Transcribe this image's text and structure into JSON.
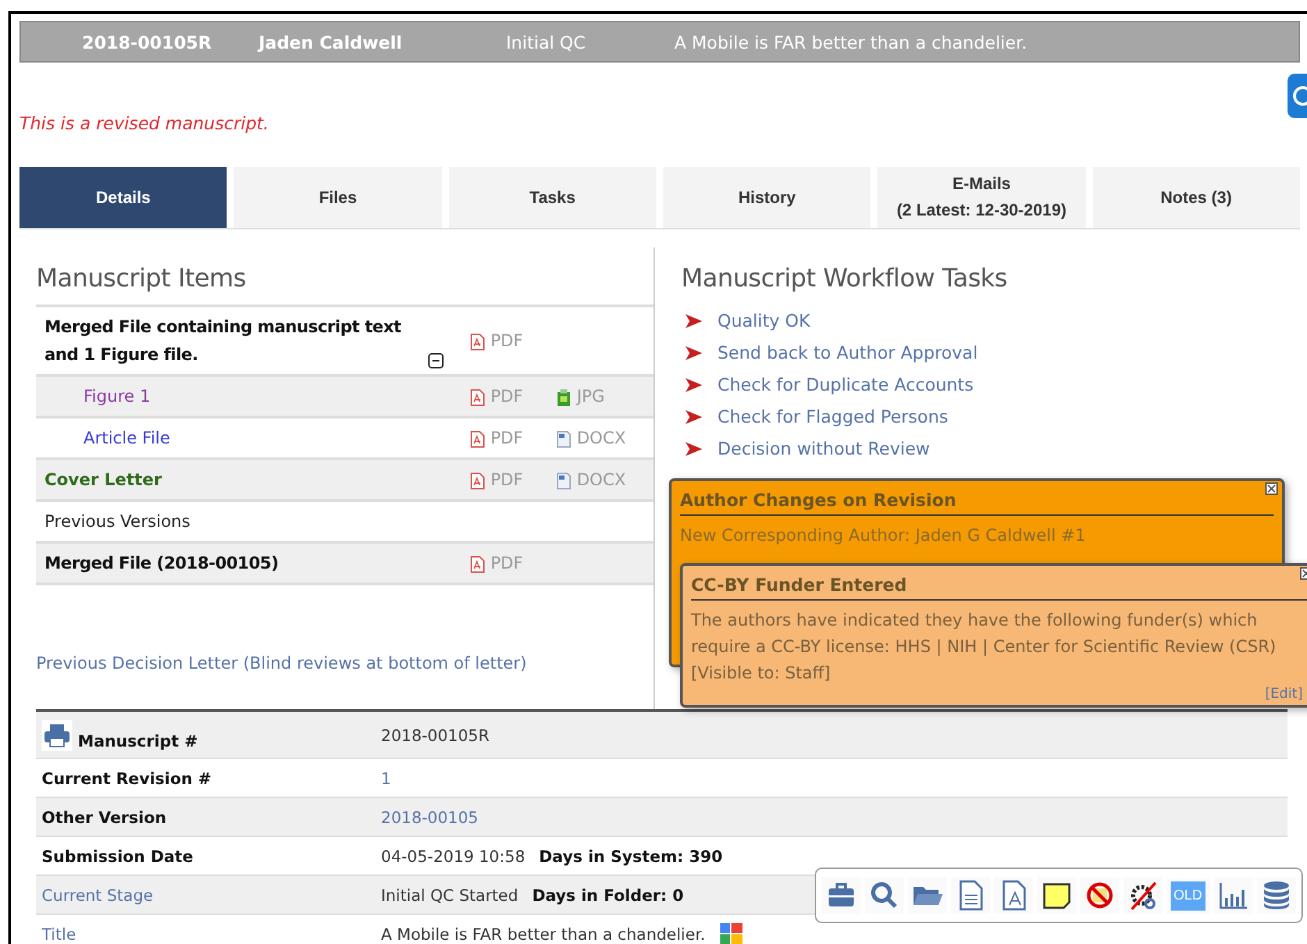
{
  "header": {
    "manuscript_id": "2018-00105R",
    "author": "Jaden Caldwell",
    "stage": "Initial QC",
    "title": "A Mobile is FAR better than a chandelier."
  },
  "revised_notice": "This is a revised manuscript.",
  "tabs": [
    {
      "label": "Details",
      "selected": true
    },
    {
      "label": "Files",
      "selected": false
    },
    {
      "label": "Tasks",
      "selected": false
    },
    {
      "label": "History",
      "selected": false
    },
    {
      "label": "E-Mails",
      "sublabel": "(2 Latest: 12-30-2019)",
      "selected": false
    },
    {
      "label": "Notes (3)",
      "selected": false
    }
  ],
  "manuscript_items": {
    "title": "Manuscript Items",
    "items": [
      {
        "label": "Merged File containing manuscript text and 1 Figure file.",
        "kind": "bold",
        "expanded": true,
        "files": [
          {
            "kind": "pdf",
            "label": "PDF"
          }
        ],
        "children": [
          {
            "label": "Figure 1",
            "kind": "visited-link",
            "files": [
              {
                "kind": "pdf",
                "label": "PDF"
              },
              {
                "kind": "image",
                "label": "JPG"
              }
            ]
          },
          {
            "label": "Article File",
            "kind": "link",
            "files": [
              {
                "kind": "pdf",
                "label": "PDF"
              },
              {
                "kind": "doc",
                "label": "DOCX"
              }
            ]
          }
        ]
      },
      {
        "label": "Cover Letter",
        "kind": "cover",
        "files": [
          {
            "kind": "pdf",
            "label": "PDF"
          },
          {
            "kind": "doc",
            "label": "DOCX"
          }
        ]
      },
      {
        "label": "Previous Versions",
        "kind": "plain"
      },
      {
        "label": "Merged File (2018-00105)",
        "kind": "bold",
        "files": [
          {
            "kind": "pdf",
            "label": "PDF"
          }
        ]
      }
    ],
    "decision_letter_link": "Previous Decision Letter (Blind reviews at bottom of letter)"
  },
  "workflow": {
    "title": "Manuscript Workflow Tasks",
    "tasks": [
      "Quality OK",
      "Send back to Author Approval",
      "Check for Duplicate Accounts",
      "Check for Flagged Persons",
      "Decision without Review"
    ]
  },
  "notes": [
    {
      "kind": "dark",
      "title": "Author Changes on Revision",
      "body": "New Corresponding Author: Jaden G Caldwell #1"
    },
    {
      "kind": "light",
      "title": "CC-BY Funder Entered",
      "body": "The authors have indicated they have the following funder(s) which require a CC-BY license: HHS | NIH | Center for Scientific Review (CSR) [Visible to: Staff]",
      "edit": "[Edit]"
    }
  ],
  "details": [
    {
      "label": "Manuscript #",
      "label_link": false,
      "print": true,
      "value": "2018-00105R",
      "value_link": false
    },
    {
      "label": "Current Revision #",
      "label_link": false,
      "value": "1",
      "value_link": true
    },
    {
      "label": "Other Version",
      "label_link": false,
      "value": "2018-00105",
      "value_link": true
    },
    {
      "label": "Submission Date",
      "label_link": false,
      "value": "04-05-2019 10:58",
      "value_link": false,
      "extra": "Days in System: 390"
    },
    {
      "label": "Current Stage",
      "label_link": true,
      "value": "Initial QC Started",
      "value_link": false,
      "extra": "Days in Folder: 0"
    },
    {
      "label": "Title",
      "label_link": true,
      "value": "A Mobile is FAR better than a chandelier.",
      "value_link": false,
      "lookup": true
    }
  ],
  "toolbar": [
    {
      "kind": "briefcase"
    },
    {
      "kind": "search"
    },
    {
      "kind": "folder"
    },
    {
      "kind": "document"
    },
    {
      "kind": "pdf"
    },
    {
      "kind": "sticky-note"
    },
    {
      "kind": "no-note"
    },
    {
      "kind": "no-gear"
    },
    {
      "kind": "badge",
      "label": "OLD"
    },
    {
      "kind": "bar-chart"
    },
    {
      "kind": "database"
    }
  ]
}
